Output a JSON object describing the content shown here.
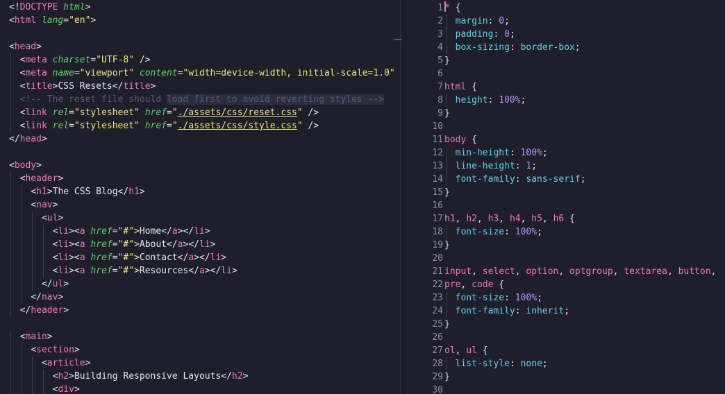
{
  "left": {
    "lines": [
      [
        [
          "p",
          "<!"
        ],
        [
          "t",
          "DOCTYPE "
        ],
        [
          "a",
          "html"
        ],
        [
          "p",
          ">"
        ]
      ],
      [
        [
          "p",
          "<"
        ],
        [
          "t",
          "html "
        ],
        [
          "a",
          "lang"
        ],
        [
          "p",
          "="
        ],
        [
          "s",
          "\"en\""
        ],
        [
          "p",
          ">"
        ]
      ],
      [],
      [
        [
          "p",
          "<"
        ],
        [
          "t",
          "head"
        ],
        [
          "p",
          ">"
        ]
      ],
      [
        [
          "i",
          "  "
        ],
        [
          "p",
          "<"
        ],
        [
          "t",
          "meta "
        ],
        [
          "a",
          "charset"
        ],
        [
          "p",
          "="
        ],
        [
          "s",
          "\"UTF-8\""
        ],
        [
          "p",
          " />"
        ]
      ],
      [
        [
          "i",
          "  "
        ],
        [
          "p",
          "<"
        ],
        [
          "t",
          "meta "
        ],
        [
          "a",
          "name"
        ],
        [
          "p",
          "="
        ],
        [
          "s",
          "\"viewport\""
        ],
        [
          "p",
          " "
        ],
        [
          "a",
          "content"
        ],
        [
          "p",
          "="
        ],
        [
          "s",
          "\"width=device-width, initial-scale=1.0\""
        ],
        [
          "p",
          " />"
        ]
      ],
      [
        [
          "i",
          "  "
        ],
        [
          "p",
          "<"
        ],
        [
          "t",
          "title"
        ],
        [
          "p",
          ">"
        ],
        [
          "tx",
          "CSS Resets"
        ],
        [
          "p",
          "</"
        ],
        [
          "t",
          "title"
        ],
        [
          "p",
          ">"
        ]
      ],
      [
        [
          "i",
          "  "
        ],
        [
          "c",
          "<!-- The reset file should "
        ],
        [
          "ch",
          "load first to avoid reverting styles -->"
        ]
      ],
      [
        [
          "i",
          "  "
        ],
        [
          "p",
          "<"
        ],
        [
          "t",
          "link "
        ],
        [
          "a",
          "rel"
        ],
        [
          "p",
          "="
        ],
        [
          "s",
          "\"stylesheet\""
        ],
        [
          "p",
          " "
        ],
        [
          "a",
          "href"
        ],
        [
          "p",
          "="
        ],
        [
          "s",
          "\""
        ],
        [
          "su",
          "./assets/css/reset.css"
        ],
        [
          "s",
          "\""
        ],
        [
          "p",
          " />"
        ]
      ],
      [
        [
          "i",
          "  "
        ],
        [
          "p",
          "<"
        ],
        [
          "t",
          "link "
        ],
        [
          "a",
          "rel"
        ],
        [
          "p",
          "="
        ],
        [
          "s",
          "\"stylesheet\""
        ],
        [
          "p",
          " "
        ],
        [
          "a",
          "href"
        ],
        [
          "p",
          "="
        ],
        [
          "s",
          "\""
        ],
        [
          "su",
          "./assets/css/style.css"
        ],
        [
          "s",
          "\""
        ],
        [
          "p",
          " />"
        ]
      ],
      [
        [
          "p",
          "</"
        ],
        [
          "t",
          "head"
        ],
        [
          "p",
          ">"
        ]
      ],
      [],
      [
        [
          "p",
          "<"
        ],
        [
          "t",
          "body"
        ],
        [
          "p",
          ">"
        ]
      ],
      [
        [
          "i",
          "  "
        ],
        [
          "p",
          "<"
        ],
        [
          "t",
          "header"
        ],
        [
          "p",
          ">"
        ]
      ],
      [
        [
          "i",
          "    "
        ],
        [
          "p",
          "<"
        ],
        [
          "t",
          "h1"
        ],
        [
          "p",
          ">"
        ],
        [
          "tx",
          "The CSS Blog"
        ],
        [
          "p",
          "</"
        ],
        [
          "t",
          "h1"
        ],
        [
          "p",
          ">"
        ]
      ],
      [
        [
          "i",
          "    "
        ],
        [
          "p",
          "<"
        ],
        [
          "t",
          "nav"
        ],
        [
          "p",
          ">"
        ]
      ],
      [
        [
          "i",
          "      "
        ],
        [
          "p",
          "<"
        ],
        [
          "t",
          "ul"
        ],
        [
          "p",
          ">"
        ]
      ],
      [
        [
          "i",
          "        "
        ],
        [
          "p",
          "<"
        ],
        [
          "t",
          "li"
        ],
        [
          "p",
          "><"
        ],
        [
          "t",
          "a "
        ],
        [
          "a",
          "href"
        ],
        [
          "p",
          "="
        ],
        [
          "s",
          "\"#\""
        ],
        [
          "p",
          ">"
        ],
        [
          "tx",
          "Home"
        ],
        [
          "p",
          "</"
        ],
        [
          "t",
          "a"
        ],
        [
          "p",
          "></"
        ],
        [
          "t",
          "li"
        ],
        [
          "p",
          ">"
        ]
      ],
      [
        [
          "i",
          "        "
        ],
        [
          "p",
          "<"
        ],
        [
          "t",
          "li"
        ],
        [
          "p",
          "><"
        ],
        [
          "t",
          "a "
        ],
        [
          "a",
          "href"
        ],
        [
          "p",
          "="
        ],
        [
          "s",
          "\"#\""
        ],
        [
          "p",
          ">"
        ],
        [
          "tx",
          "About"
        ],
        [
          "p",
          "</"
        ],
        [
          "t",
          "a"
        ],
        [
          "p",
          "></"
        ],
        [
          "t",
          "li"
        ],
        [
          "p",
          ">"
        ]
      ],
      [
        [
          "i",
          "        "
        ],
        [
          "p",
          "<"
        ],
        [
          "t",
          "li"
        ],
        [
          "p",
          "><"
        ],
        [
          "t",
          "a "
        ],
        [
          "a",
          "href"
        ],
        [
          "p",
          "="
        ],
        [
          "s",
          "\"#\""
        ],
        [
          "p",
          ">"
        ],
        [
          "tx",
          "Contact"
        ],
        [
          "p",
          "</"
        ],
        [
          "t",
          "a"
        ],
        [
          "p",
          "></"
        ],
        [
          "t",
          "li"
        ],
        [
          "p",
          ">"
        ]
      ],
      [
        [
          "i",
          "        "
        ],
        [
          "p",
          "<"
        ],
        [
          "t",
          "li"
        ],
        [
          "p",
          "><"
        ],
        [
          "t",
          "a "
        ],
        [
          "a",
          "href"
        ],
        [
          "p",
          "="
        ],
        [
          "s",
          "\"#\""
        ],
        [
          "p",
          ">"
        ],
        [
          "tx",
          "Resources"
        ],
        [
          "p",
          "</"
        ],
        [
          "t",
          "a"
        ],
        [
          "p",
          "></"
        ],
        [
          "t",
          "li"
        ],
        [
          "p",
          ">"
        ]
      ],
      [
        [
          "i",
          "      "
        ],
        [
          "p",
          "</"
        ],
        [
          "t",
          "ul"
        ],
        [
          "p",
          ">"
        ]
      ],
      [
        [
          "i",
          "    "
        ],
        [
          "p",
          "</"
        ],
        [
          "t",
          "nav"
        ],
        [
          "p",
          ">"
        ]
      ],
      [
        [
          "i",
          "  "
        ],
        [
          "p",
          "</"
        ],
        [
          "t",
          "header"
        ],
        [
          "p",
          ">"
        ]
      ],
      [],
      [
        [
          "i",
          "  "
        ],
        [
          "p",
          "<"
        ],
        [
          "t",
          "main"
        ],
        [
          "p",
          ">"
        ]
      ],
      [
        [
          "i",
          "    "
        ],
        [
          "p",
          "<"
        ],
        [
          "t",
          "section"
        ],
        [
          "p",
          ">"
        ]
      ],
      [
        [
          "i",
          "      "
        ],
        [
          "p",
          "<"
        ],
        [
          "t",
          "article"
        ],
        [
          "p",
          ">"
        ]
      ],
      [
        [
          "i",
          "        "
        ],
        [
          "p",
          "<"
        ],
        [
          "t",
          "h2"
        ],
        [
          "p",
          ">"
        ],
        [
          "tx",
          "Building Responsive Layouts"
        ],
        [
          "p",
          "</"
        ],
        [
          "t",
          "h2"
        ],
        [
          "p",
          ">"
        ]
      ],
      [
        [
          "i",
          "        "
        ],
        [
          "p",
          "<"
        ],
        [
          "t",
          "div"
        ],
        [
          "p",
          ">"
        ]
      ]
    ]
  },
  "right": {
    "line_numbers": [
      "1",
      "2",
      "3",
      "4",
      "5",
      "6",
      "7",
      "8",
      "9",
      "10",
      "11",
      "12",
      "13",
      "14",
      "15",
      "16",
      "17",
      "18",
      "19",
      "20",
      "21",
      "22",
      "23",
      "24",
      "25",
      "26",
      "27",
      "28",
      "29",
      "30"
    ],
    "lines": [
      [
        [
          "t",
          "*"
        ],
        [
          "p",
          " {"
        ]
      ],
      [
        [
          "i",
          "  "
        ],
        [
          "pr",
          "margin"
        ],
        [
          "p",
          ": "
        ],
        [
          "v",
          "0"
        ],
        [
          "p",
          ";"
        ]
      ],
      [
        [
          "i",
          "  "
        ],
        [
          "pr",
          "padding"
        ],
        [
          "p",
          ": "
        ],
        [
          "v",
          "0"
        ],
        [
          "p",
          ";"
        ]
      ],
      [
        [
          "i",
          "  "
        ],
        [
          "pr",
          "box-sizing"
        ],
        [
          "p",
          ": "
        ],
        [
          "pr",
          "border-box"
        ],
        [
          "p",
          ";"
        ]
      ],
      [
        [
          "p",
          "}"
        ]
      ],
      [],
      [
        [
          "t",
          "html"
        ],
        [
          "p",
          " {"
        ]
      ],
      [
        [
          "i",
          "  "
        ],
        [
          "pr",
          "height"
        ],
        [
          "p",
          ": "
        ],
        [
          "v",
          "100%"
        ],
        [
          "p",
          ";"
        ]
      ],
      [
        [
          "p",
          "}"
        ]
      ],
      [],
      [
        [
          "t",
          "body"
        ],
        [
          "p",
          " {"
        ]
      ],
      [
        [
          "i",
          "  "
        ],
        [
          "pr",
          "min-height"
        ],
        [
          "p",
          ": "
        ],
        [
          "v",
          "100%"
        ],
        [
          "p",
          ";"
        ]
      ],
      [
        [
          "i",
          "  "
        ],
        [
          "pr",
          "line-height"
        ],
        [
          "p",
          ": "
        ],
        [
          "v",
          "1"
        ],
        [
          "p",
          ";"
        ]
      ],
      [
        [
          "i",
          "  "
        ],
        [
          "pr",
          "font-family"
        ],
        [
          "p",
          ": "
        ],
        [
          "pr",
          "sans-serif"
        ],
        [
          "p",
          ";"
        ]
      ],
      [
        [
          "p",
          "}"
        ]
      ],
      [],
      [
        [
          "t",
          "h1"
        ],
        [
          "p",
          ", "
        ],
        [
          "t",
          "h2"
        ],
        [
          "p",
          ", "
        ],
        [
          "t",
          "h3"
        ],
        [
          "p",
          ", "
        ],
        [
          "t",
          "h4"
        ],
        [
          "p",
          ", "
        ],
        [
          "t",
          "h5"
        ],
        [
          "p",
          ", "
        ],
        [
          "t",
          "h6"
        ],
        [
          "p",
          " {"
        ]
      ],
      [
        [
          "i",
          "  "
        ],
        [
          "pr",
          "font-size"
        ],
        [
          "p",
          ": "
        ],
        [
          "v",
          "100%"
        ],
        [
          "p",
          ";"
        ]
      ],
      [
        [
          "p",
          "}"
        ]
      ],
      [],
      [
        [
          "t",
          "input"
        ],
        [
          "p",
          ", "
        ],
        [
          "t",
          "select"
        ],
        [
          "p",
          ", "
        ],
        [
          "t",
          "option"
        ],
        [
          "p",
          ", "
        ],
        [
          "t",
          "optgroup"
        ],
        [
          "p",
          ", "
        ],
        [
          "t",
          "textarea"
        ],
        [
          "p",
          ", "
        ],
        [
          "t",
          "button"
        ],
        [
          "p",
          ","
        ]
      ],
      [
        [
          "t",
          "pre"
        ],
        [
          "p",
          ", "
        ],
        [
          "t",
          "code"
        ],
        [
          "p",
          " {"
        ]
      ],
      [
        [
          "i",
          "  "
        ],
        [
          "pr",
          "font-size"
        ],
        [
          "p",
          ": "
        ],
        [
          "v",
          "100%"
        ],
        [
          "p",
          ";"
        ]
      ],
      [
        [
          "i",
          "  "
        ],
        [
          "pr",
          "font-family"
        ],
        [
          "p",
          ": "
        ],
        [
          "pr",
          "inherit"
        ],
        [
          "p",
          ";"
        ]
      ],
      [
        [
          "p",
          "}"
        ]
      ],
      [],
      [
        [
          "t",
          "ol"
        ],
        [
          "p",
          ", "
        ],
        [
          "t",
          "ul"
        ],
        [
          "p",
          " {"
        ]
      ],
      [
        [
          "i",
          "  "
        ],
        [
          "pr",
          "list-style"
        ],
        [
          "p",
          ": "
        ],
        [
          "pr",
          "none"
        ],
        [
          "p",
          ";"
        ]
      ],
      [
        [
          "p",
          "}"
        ]
      ],
      []
    ]
  }
}
